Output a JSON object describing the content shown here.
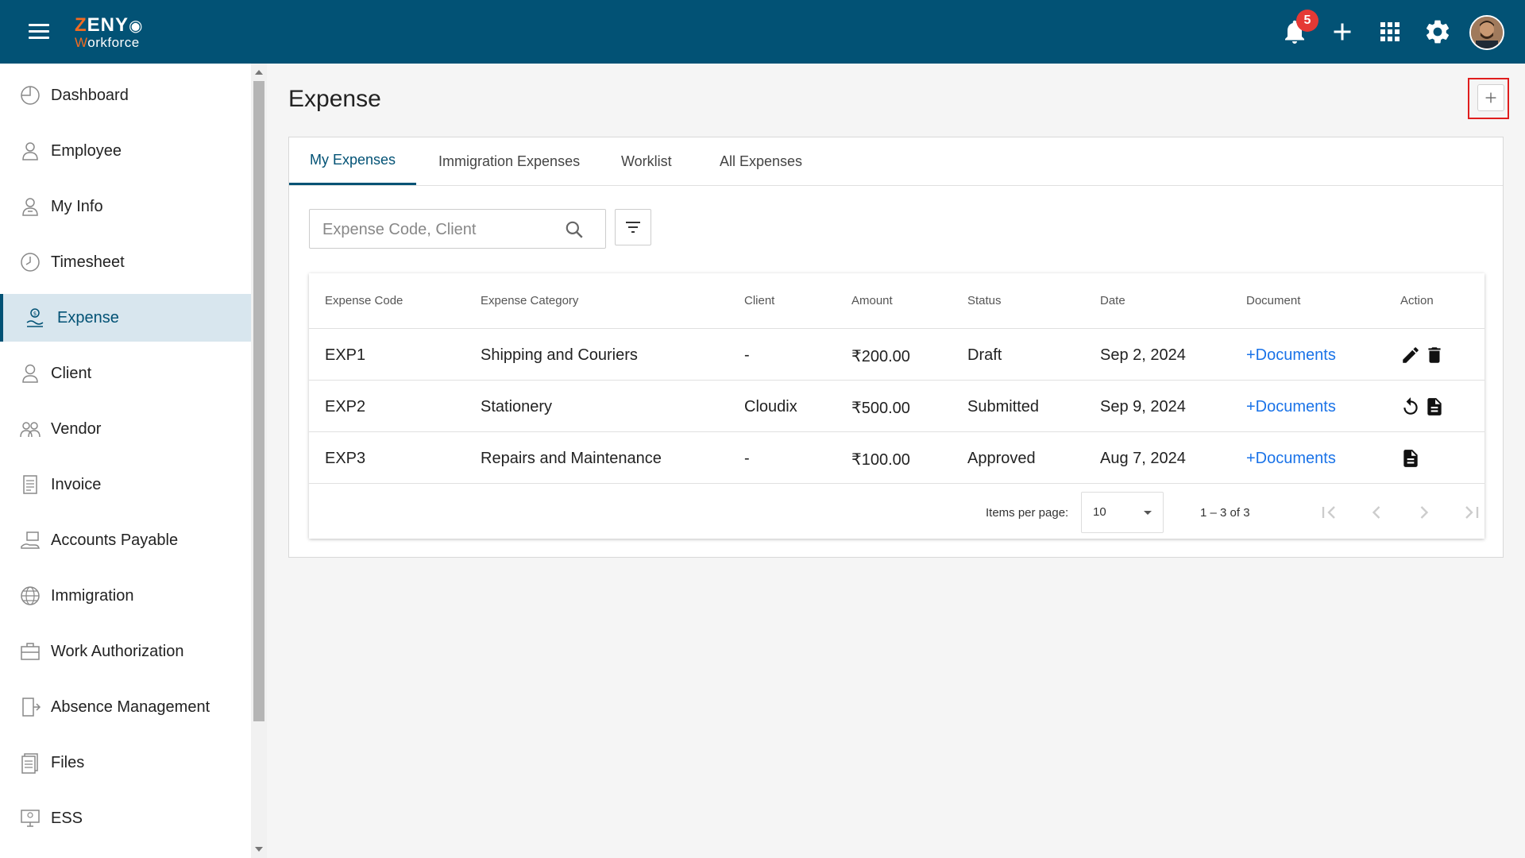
{
  "app": {
    "logo_top": "ZENYO",
    "logo_bottom": "Workforce",
    "notification_count": "5"
  },
  "sidebar": {
    "items": [
      {
        "label": "Dashboard",
        "icon": "dashboard-icon"
      },
      {
        "label": "Employee",
        "icon": "employee-icon"
      },
      {
        "label": "My Info",
        "icon": "my-info-icon"
      },
      {
        "label": "Timesheet",
        "icon": "clock-icon"
      },
      {
        "label": "Expense",
        "icon": "expense-icon",
        "active": true
      },
      {
        "label": "Client",
        "icon": "client-icon"
      },
      {
        "label": "Vendor",
        "icon": "vendor-icon"
      },
      {
        "label": "Invoice",
        "icon": "invoice-icon"
      },
      {
        "label": "Accounts Payable",
        "icon": "accounts-payable-icon"
      },
      {
        "label": "Immigration",
        "icon": "globe-icon"
      },
      {
        "label": "Work Authorization",
        "icon": "briefcase-icon"
      },
      {
        "label": "Absence Management",
        "icon": "exit-door-icon"
      },
      {
        "label": "Files",
        "icon": "files-icon"
      },
      {
        "label": "ESS",
        "icon": "ess-icon"
      }
    ]
  },
  "main": {
    "title": "Expense",
    "tabs": [
      {
        "label": "My Expenses",
        "active": true
      },
      {
        "label": "Immigration Expenses"
      },
      {
        "label": "Worklist"
      },
      {
        "label": "All Expenses"
      }
    ],
    "search": {
      "placeholder": "Expense Code, Client",
      "value": ""
    },
    "table": {
      "columns": [
        "Expense Code",
        "Expense Category",
        "Client",
        "Amount",
        "Status",
        "Date",
        "Document",
        "Action"
      ],
      "rows": [
        {
          "code": "EXP1",
          "category": "Shipping and Couriers",
          "client": "-",
          "amount": "₹200.00",
          "status": "Draft",
          "date": "Sep 2, 2024",
          "document": "+Documents",
          "actions": [
            "edit-icon",
            "delete-icon"
          ]
        },
        {
          "code": "EXP2",
          "category": "Stationery",
          "client": "Cloudix",
          "amount": "₹500.00",
          "status": "Submitted",
          "date": "Sep 9, 2024",
          "document": "+Documents",
          "actions": [
            "undo-icon",
            "document-icon"
          ]
        },
        {
          "code": "EXP3",
          "category": "Repairs and Maintenance",
          "client": "-",
          "amount": "₹100.00",
          "status": "Approved",
          "date": "Aug 7, 2024",
          "document": "+Documents",
          "actions": [
            "document-icon"
          ]
        }
      ]
    },
    "pagination": {
      "items_per_page_label": "Items per page:",
      "items_per_page": "10",
      "range": "1 – 3 of 3"
    }
  },
  "colors": {
    "topbar": "#025275",
    "accent": "#025275",
    "link": "#1a73e8",
    "badge": "#e53935",
    "highlight": "#e01e1e",
    "brand_orange": "#f26b21"
  }
}
